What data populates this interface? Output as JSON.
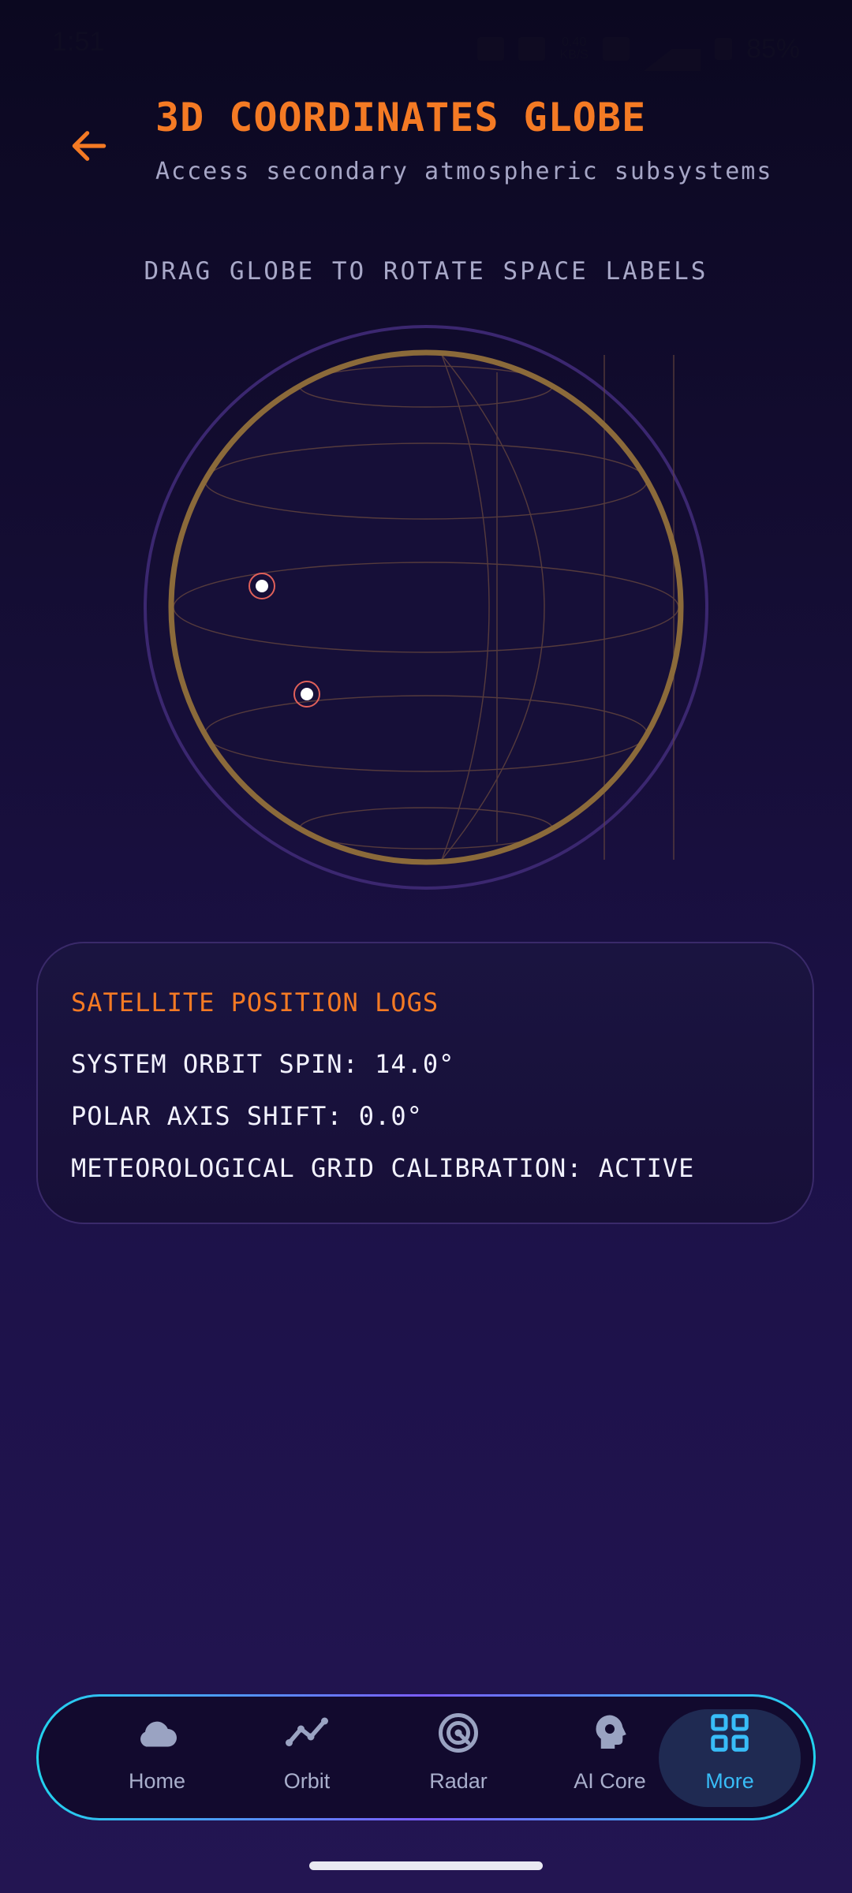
{
  "status_bar": {
    "time": "1:51",
    "net_speed": "0.40\nKB/S",
    "battery": "85%"
  },
  "header": {
    "title": "3D COORDINATES GLOBE",
    "subtitle": "Access secondary atmospheric subsystems"
  },
  "hint": "DRAG GLOBE TO ROTATE SPACE LABELS",
  "colors": {
    "accent_orange": "#f47a24",
    "globe_ring": "#8b6a3a",
    "outer_ring": "#3b2770",
    "nav_active": "#38bdf8"
  },
  "log_card": {
    "title": "SATELLITE POSITION LOGS",
    "lines": [
      "SYSTEM ORBIT SPIN: 14.0°",
      "POLAR AXIS SHIFT: 0.0°",
      "METEOROLOGICAL GRID CALIBRATION: ACTIVE"
    ]
  },
  "nav": {
    "items": [
      {
        "label": "Home",
        "icon": "cloud-icon"
      },
      {
        "label": "Orbit",
        "icon": "trend-line-icon"
      },
      {
        "label": "Radar",
        "icon": "radar-icon"
      },
      {
        "label": "AI Core",
        "icon": "brain-gear-icon"
      },
      {
        "label": "More",
        "icon": "grid-icon"
      }
    ],
    "active": "More"
  }
}
